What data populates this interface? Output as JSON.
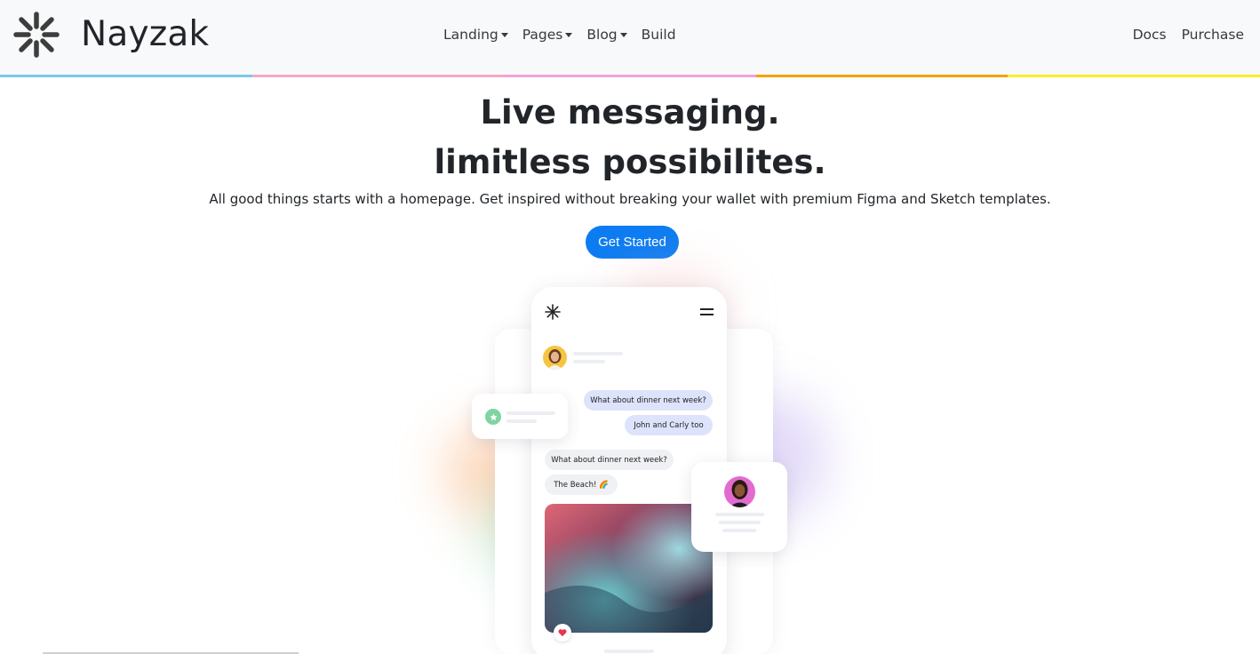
{
  "brand": {
    "name": "Nayzak",
    "logo_icon": "asterisk-spark-icon"
  },
  "nav": {
    "center": [
      {
        "label": "Landing",
        "dropdown": true
      },
      {
        "label": "Pages",
        "dropdown": true
      },
      {
        "label": "Blog",
        "dropdown": true
      },
      {
        "label": "Build",
        "dropdown": false
      }
    ],
    "right": [
      {
        "label": "Docs"
      },
      {
        "label": "Purchase"
      }
    ]
  },
  "accent_strip_colors": [
    "#7cc7e8",
    "#f4a8c8",
    "#f0a3d8",
    "#f5a200",
    "#f8ee2a"
  ],
  "hero": {
    "title_line1": "Live messaging.",
    "title_line2": "limitless possibilites.",
    "subtitle": "All good things starts with a homepage. Get inspired without breaking your wallet with premium Figma and Sketch templates.",
    "cta_label": "Get Started",
    "cta_color": "#0d7cf2"
  },
  "mockup": {
    "messages_sent": [
      "What about dinner next week?",
      "John and Carly too"
    ],
    "messages_received": [
      "What about dinner next week?",
      "The Beach! 🌈"
    ],
    "icons": [
      "asterisk-spark-icon",
      "hamburger-menu-icon",
      "star-icon",
      "heart-icon"
    ]
  }
}
